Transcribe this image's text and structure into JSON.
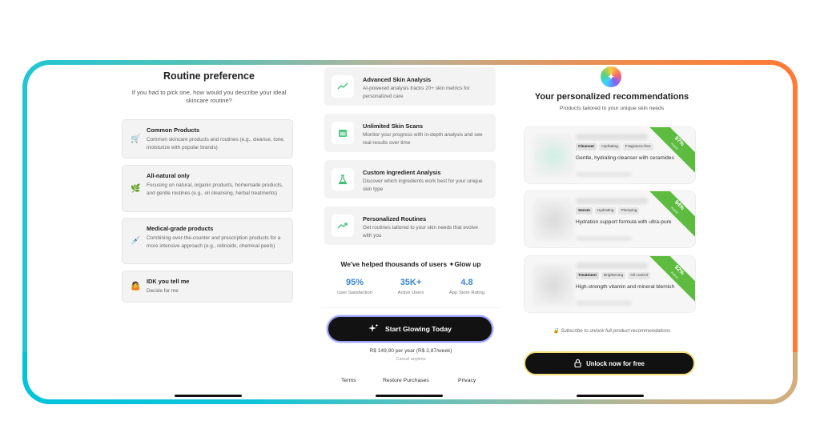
{
  "routine": {
    "title": "Routine preference",
    "subtitle": "If you had to pick one, how would you describe your ideal skincare routine?",
    "options": [
      {
        "icon": "shopping-cart-icon",
        "glyph": "🛒",
        "title": "Common Products",
        "desc": "Common skincare products and routines (e.g., cleanse, tone, moisturize with popular brands)"
      },
      {
        "icon": "leaf-icon",
        "glyph": "🌿",
        "title": "All-natural only",
        "desc": "Focusing on natural, organic products, homemade products, and gentle routines (e.g., oil cleansing, herbal treatments)"
      },
      {
        "icon": "syringe-icon",
        "glyph": "💉",
        "title": "Medical-grade products",
        "desc": "Combining over-the-counter and prescription products for a more intensive approach (e.g., retinoids, chemical peels)"
      },
      {
        "icon": "shrug-person-icon",
        "glyph": "🤷",
        "title": "IDK you tell me",
        "desc": "Decide for me"
      }
    ]
  },
  "features": [
    {
      "icon": "trend-line-icon",
      "title": "Advanced Skin Analysis",
      "desc": "AI-powered analysis tracks 20+ skin metrics for personalized care"
    },
    {
      "icon": "calendar-icon",
      "title": "Unlimited Skin Scans",
      "desc": "Monitor your progress with in-depth analysis and see real results over time"
    },
    {
      "icon": "flask-icon",
      "title": "Custom Ingredient Analysis",
      "desc": "Discover which ingredients work best for your unique skin type"
    },
    {
      "icon": "trending-up-icon",
      "title": "Personalized Routines",
      "desc": "Get routines tailored to your skin needs that evolve with you"
    }
  ],
  "social": {
    "headline": "We've helped thousands of users ✦Glow up",
    "stats": [
      {
        "value": "95%",
        "label": "User Satisfaction"
      },
      {
        "value": "35K+",
        "label": "Active Users"
      },
      {
        "value": "4.8",
        "label": "App Store Rating"
      }
    ]
  },
  "paywall": {
    "cta_label": "Start Glowing Today",
    "price": "R$ 149,90 per year (R$ 2,87/week)",
    "cancel": "Cancel anytime",
    "links": [
      "Terms",
      "Restore Purchases",
      "Privacy"
    ]
  },
  "recommendations": {
    "title": "Your personalized recommendations",
    "subtitle": "Products tailored to your unique skin needs",
    "cards": [
      {
        "tags": [
          "Cleanser",
          "Hydrating",
          "Fragrance-free"
        ],
        "desc": "Gentle, hydrating cleanser with ceramides",
        "match": "97%",
        "match_label": "match"
      },
      {
        "tags": [
          "Serum",
          "Hydrating",
          "Plumping"
        ],
        "desc": "Hydration support formula with ultra-pure",
        "match": "94%",
        "match_label": "match"
      },
      {
        "tags": [
          "Treatment",
          "Brightening",
          "Oil control"
        ],
        "desc": "High-strength vitamin and mineral blemish",
        "match": "92%",
        "match_label": "match"
      }
    ],
    "subscribe_note": "Subscribe to unlock full product recommendations",
    "unlock_label": "Unlock now for free"
  },
  "colors": {
    "accent_blue": "#3a86d0",
    "match_green": "#5dbb3f",
    "cta_border": "#9aa0ff",
    "unlock_border": "#f3de7a"
  }
}
